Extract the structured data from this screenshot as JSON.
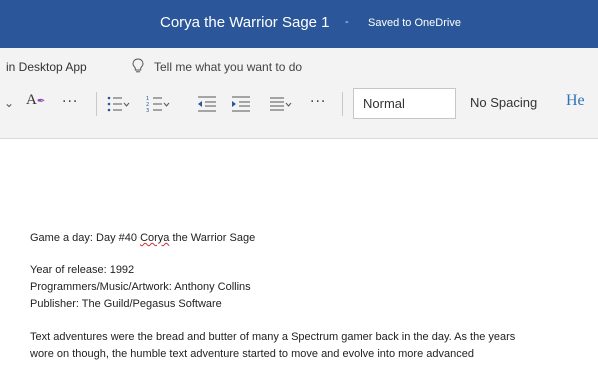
{
  "titlebar": {
    "document_name": "Corya the Warrior Sage 1",
    "separator": "-",
    "save_status": "Saved to OneDrive"
  },
  "commandbar": {
    "open_in_desktop": "in Desktop App",
    "tell_me": "Tell me what you want to do"
  },
  "ribbon": {
    "font_color_label": "A",
    "more": "···",
    "styles": {
      "normal": "Normal",
      "no_spacing": "No Spacing",
      "heading": "He"
    },
    "icons": [
      "chevron-icon",
      "font-color-icon",
      "bullets-icon",
      "numbering-icon",
      "decrease-indent-icon",
      "increase-indent-icon",
      "align-icon"
    ]
  },
  "document": {
    "line1_prefix": "Game a day: Day #40 ",
    "line1_misspelled": "Corya",
    "line1_suffix": " the Warrior Sage",
    "year": "Year of release: 1992",
    "programmers": "Programmers/Music/Artwork: Anthony Collins",
    "publisher": "Publisher: The Guild/Pegasus Software",
    "para1": "Text adventures were the bread and butter of many a Spectrum gamer back in the day. As the years",
    "para2": "wore on though, the humble text adventure started to move and evolve into more advanced"
  },
  "colors": {
    "titlebar": "#2b579a",
    "heading_style": "#2e74b5",
    "spellcheck": "#d32f2f"
  }
}
